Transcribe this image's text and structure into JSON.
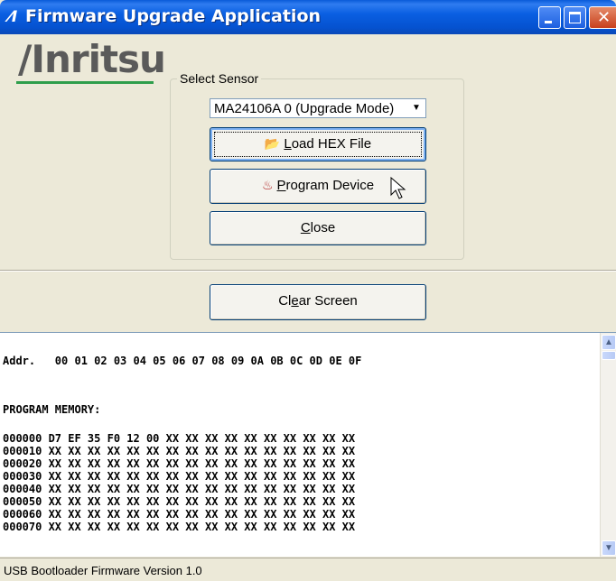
{
  "window": {
    "title": "Firmware Upgrade Application",
    "title_icon": "⁄I"
  },
  "logo": {
    "text": "/Inritsu"
  },
  "sensor_group": {
    "label": "Select Sensor",
    "dropdown_value": "MA24106A 0 (Upgrade Mode)",
    "buttons": {
      "load_hex_prefix": "",
      "load_hex_mnemonic": "L",
      "load_hex_rest": "oad HEX File",
      "program_mnemonic": "P",
      "program_rest": "rogram Device",
      "close_mnemonic": "C",
      "close_rest": "lose"
    }
  },
  "clear": {
    "prefix": "Cl",
    "mnemonic": "e",
    "rest": "ar Screen"
  },
  "memory": {
    "lines": [
      "Addr.   00 01 02 03 04 05 06 07 08 09 0A 0B 0C 0D 0E 0F",
      "",
      "",
      "PROGRAM MEMORY:",
      "",
      "000000 D7 EF 35 F0 12 00 XX XX XX XX XX XX XX XX XX XX",
      "000010 XX XX XX XX XX XX XX XX XX XX XX XX XX XX XX XX",
      "000020 XX XX XX XX XX XX XX XX XX XX XX XX XX XX XX XX",
      "000030 XX XX XX XX XX XX XX XX XX XX XX XX XX XX XX XX",
      "000040 XX XX XX XX XX XX XX XX XX XX XX XX XX XX XX XX",
      "000050 XX XX XX XX XX XX XX XX XX XX XX XX XX XX XX XX",
      "000060 XX XX XX XX XX XX XX XX XX XX XX XX XX XX XX XX",
      "000070 XX XX XX XX XX XX XX XX XX XX XX XX XX XX XX XX"
    ]
  },
  "status": {
    "text": "USB Bootloader Firmware Version 1.0"
  },
  "icons": {
    "folder": "folder-open-icon",
    "program": "chip-program-icon"
  },
  "colors": {
    "titlebar": "#0a5fe2",
    "logo_underline": "#2e9e4b",
    "dialog_bg": "#ece9d8"
  }
}
